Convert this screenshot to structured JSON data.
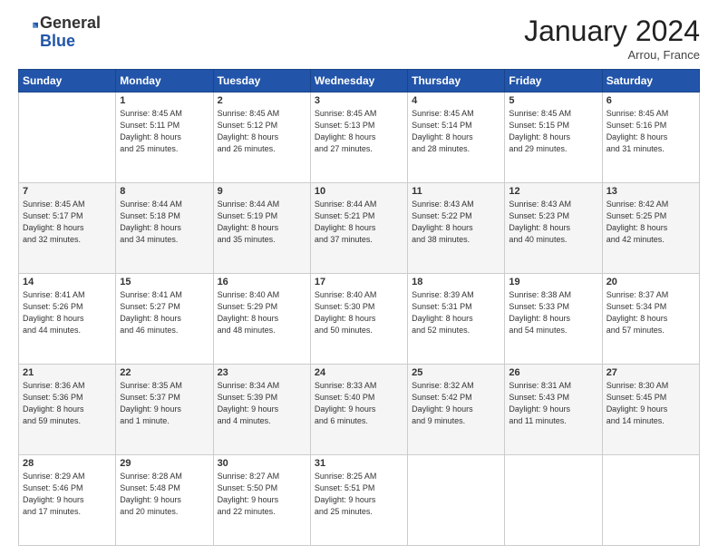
{
  "header": {
    "logo_general": "General",
    "logo_blue": "Blue",
    "month_title": "January 2024",
    "location": "Arrou, France"
  },
  "weekdays": [
    "Sunday",
    "Monday",
    "Tuesday",
    "Wednesday",
    "Thursday",
    "Friday",
    "Saturday"
  ],
  "weeks": [
    {
      "shade": "row-white",
      "days": [
        {
          "num": "",
          "info": ""
        },
        {
          "num": "1",
          "info": "Sunrise: 8:45 AM\nSunset: 5:11 PM\nDaylight: 8 hours\nand 25 minutes."
        },
        {
          "num": "2",
          "info": "Sunrise: 8:45 AM\nSunset: 5:12 PM\nDaylight: 8 hours\nand 26 minutes."
        },
        {
          "num": "3",
          "info": "Sunrise: 8:45 AM\nSunset: 5:13 PM\nDaylight: 8 hours\nand 27 minutes."
        },
        {
          "num": "4",
          "info": "Sunrise: 8:45 AM\nSunset: 5:14 PM\nDaylight: 8 hours\nand 28 minutes."
        },
        {
          "num": "5",
          "info": "Sunrise: 8:45 AM\nSunset: 5:15 PM\nDaylight: 8 hours\nand 29 minutes."
        },
        {
          "num": "6",
          "info": "Sunrise: 8:45 AM\nSunset: 5:16 PM\nDaylight: 8 hours\nand 31 minutes."
        }
      ]
    },
    {
      "shade": "row-shade",
      "days": [
        {
          "num": "7",
          "info": "Sunrise: 8:45 AM\nSunset: 5:17 PM\nDaylight: 8 hours\nand 32 minutes."
        },
        {
          "num": "8",
          "info": "Sunrise: 8:44 AM\nSunset: 5:18 PM\nDaylight: 8 hours\nand 34 minutes."
        },
        {
          "num": "9",
          "info": "Sunrise: 8:44 AM\nSunset: 5:19 PM\nDaylight: 8 hours\nand 35 minutes."
        },
        {
          "num": "10",
          "info": "Sunrise: 8:44 AM\nSunset: 5:21 PM\nDaylight: 8 hours\nand 37 minutes."
        },
        {
          "num": "11",
          "info": "Sunrise: 8:43 AM\nSunset: 5:22 PM\nDaylight: 8 hours\nand 38 minutes."
        },
        {
          "num": "12",
          "info": "Sunrise: 8:43 AM\nSunset: 5:23 PM\nDaylight: 8 hours\nand 40 minutes."
        },
        {
          "num": "13",
          "info": "Sunrise: 8:42 AM\nSunset: 5:25 PM\nDaylight: 8 hours\nand 42 minutes."
        }
      ]
    },
    {
      "shade": "row-white",
      "days": [
        {
          "num": "14",
          "info": "Sunrise: 8:41 AM\nSunset: 5:26 PM\nDaylight: 8 hours\nand 44 minutes."
        },
        {
          "num": "15",
          "info": "Sunrise: 8:41 AM\nSunset: 5:27 PM\nDaylight: 8 hours\nand 46 minutes."
        },
        {
          "num": "16",
          "info": "Sunrise: 8:40 AM\nSunset: 5:29 PM\nDaylight: 8 hours\nand 48 minutes."
        },
        {
          "num": "17",
          "info": "Sunrise: 8:40 AM\nSunset: 5:30 PM\nDaylight: 8 hours\nand 50 minutes."
        },
        {
          "num": "18",
          "info": "Sunrise: 8:39 AM\nSunset: 5:31 PM\nDaylight: 8 hours\nand 52 minutes."
        },
        {
          "num": "19",
          "info": "Sunrise: 8:38 AM\nSunset: 5:33 PM\nDaylight: 8 hours\nand 54 minutes."
        },
        {
          "num": "20",
          "info": "Sunrise: 8:37 AM\nSunset: 5:34 PM\nDaylight: 8 hours\nand 57 minutes."
        }
      ]
    },
    {
      "shade": "row-shade",
      "days": [
        {
          "num": "21",
          "info": "Sunrise: 8:36 AM\nSunset: 5:36 PM\nDaylight: 8 hours\nand 59 minutes."
        },
        {
          "num": "22",
          "info": "Sunrise: 8:35 AM\nSunset: 5:37 PM\nDaylight: 9 hours\nand 1 minute."
        },
        {
          "num": "23",
          "info": "Sunrise: 8:34 AM\nSunset: 5:39 PM\nDaylight: 9 hours\nand 4 minutes."
        },
        {
          "num": "24",
          "info": "Sunrise: 8:33 AM\nSunset: 5:40 PM\nDaylight: 9 hours\nand 6 minutes."
        },
        {
          "num": "25",
          "info": "Sunrise: 8:32 AM\nSunset: 5:42 PM\nDaylight: 9 hours\nand 9 minutes."
        },
        {
          "num": "26",
          "info": "Sunrise: 8:31 AM\nSunset: 5:43 PM\nDaylight: 9 hours\nand 11 minutes."
        },
        {
          "num": "27",
          "info": "Sunrise: 8:30 AM\nSunset: 5:45 PM\nDaylight: 9 hours\nand 14 minutes."
        }
      ]
    },
    {
      "shade": "row-white",
      "days": [
        {
          "num": "28",
          "info": "Sunrise: 8:29 AM\nSunset: 5:46 PM\nDaylight: 9 hours\nand 17 minutes."
        },
        {
          "num": "29",
          "info": "Sunrise: 8:28 AM\nSunset: 5:48 PM\nDaylight: 9 hours\nand 20 minutes."
        },
        {
          "num": "30",
          "info": "Sunrise: 8:27 AM\nSunset: 5:50 PM\nDaylight: 9 hours\nand 22 minutes."
        },
        {
          "num": "31",
          "info": "Sunrise: 8:25 AM\nSunset: 5:51 PM\nDaylight: 9 hours\nand 25 minutes."
        },
        {
          "num": "",
          "info": ""
        },
        {
          "num": "",
          "info": ""
        },
        {
          "num": "",
          "info": ""
        }
      ]
    }
  ]
}
